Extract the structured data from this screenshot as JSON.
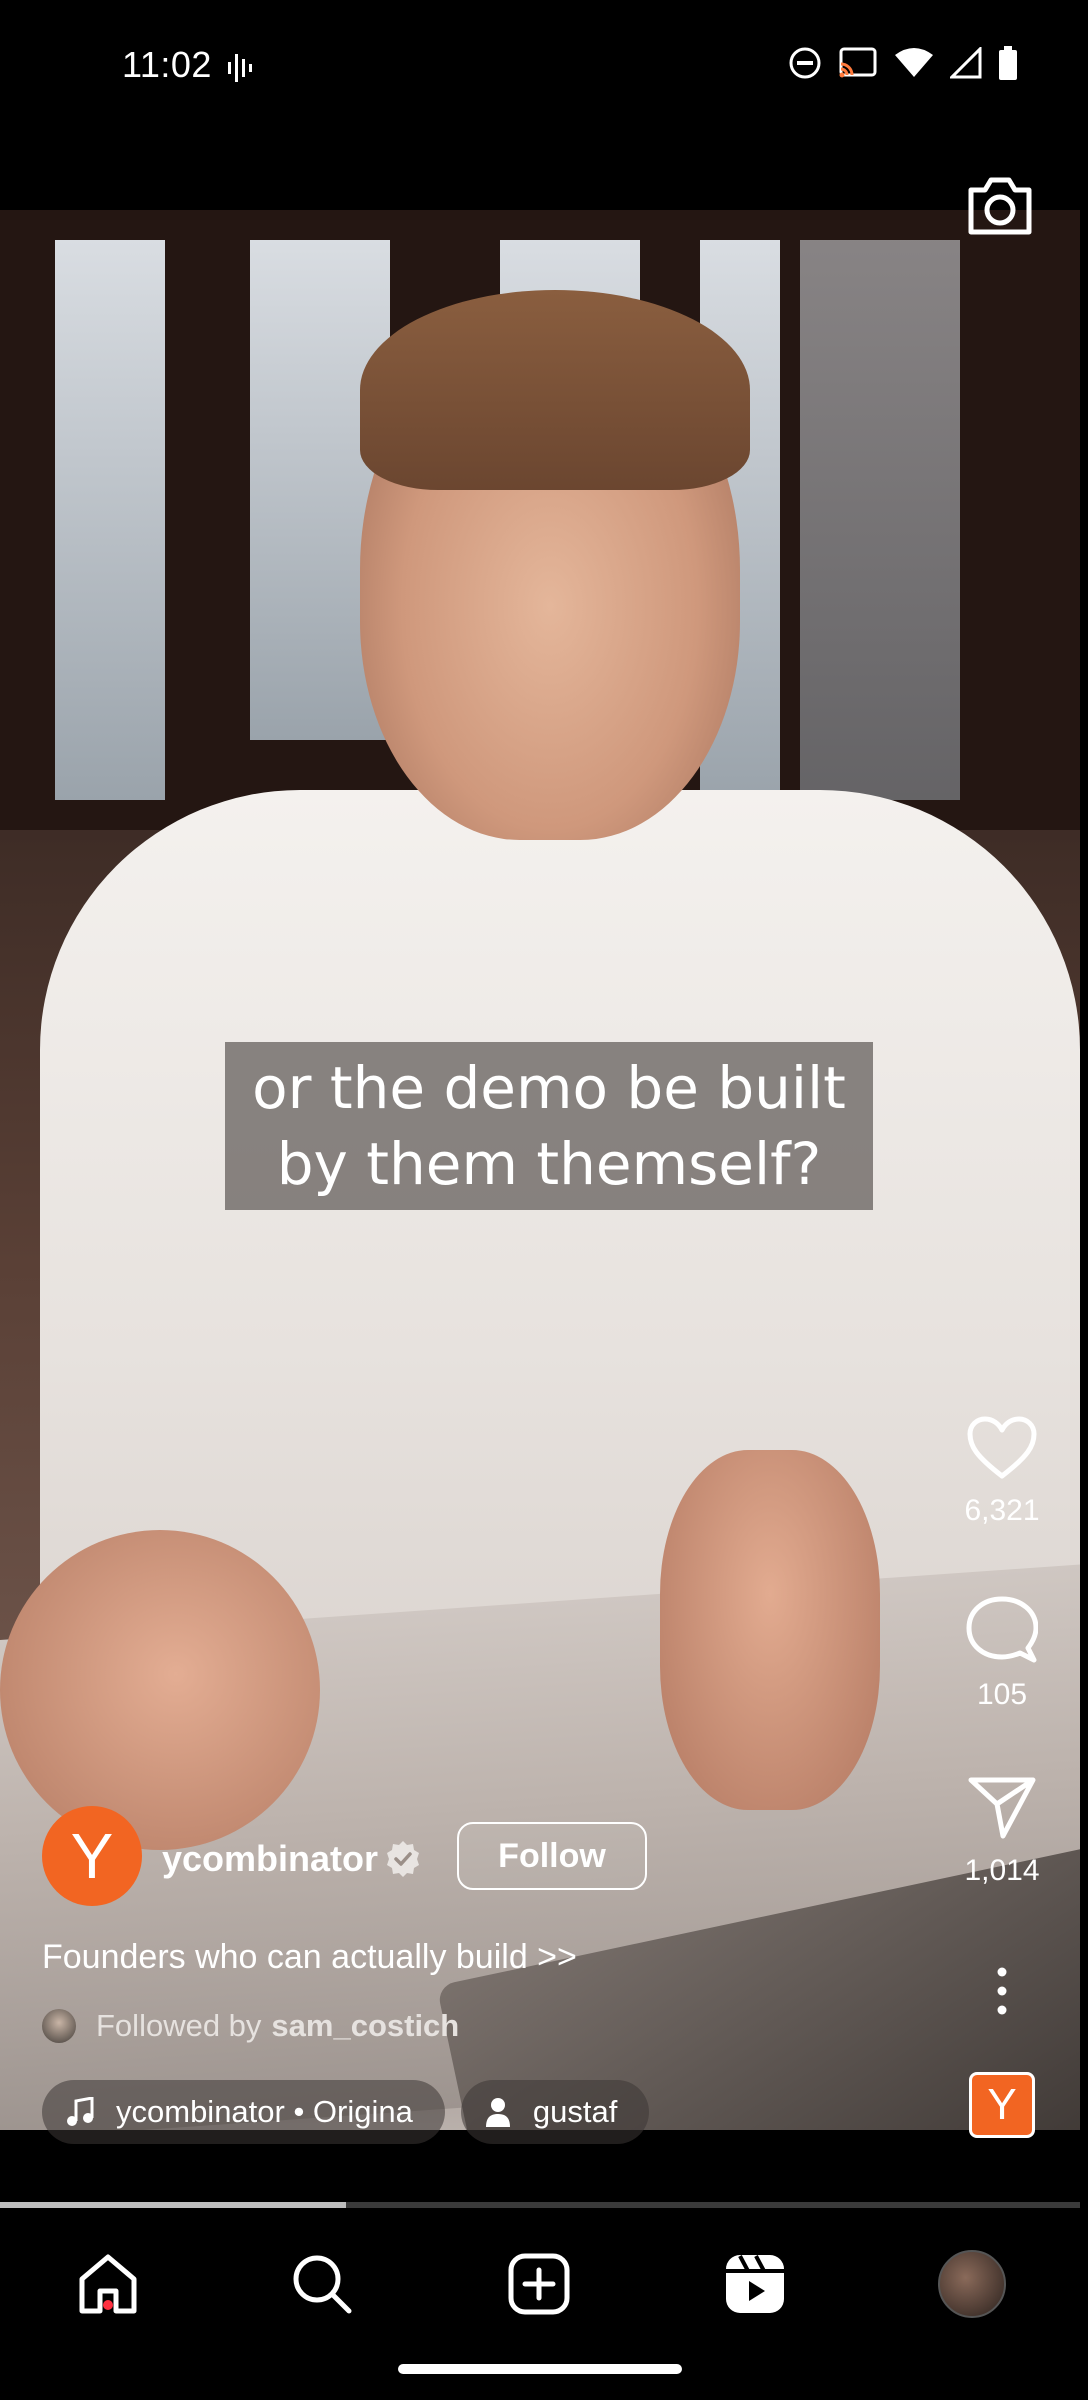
{
  "status_bar": {
    "time": "11:02"
  },
  "caption": {
    "line1": "or the demo be built",
    "line2": "by them themself?"
  },
  "actions": {
    "likes": "6,321",
    "comments": "105",
    "shares": "1,014"
  },
  "post": {
    "avatar_letter": "Y",
    "username": "ycombinator",
    "follow_label": "Follow",
    "description": "Founders who can actually build >>",
    "followed_by_prefix": "Followed by",
    "followed_by_user": "sam_costich",
    "audio_chip": "ycombinator • Origina",
    "tag_chip": "gustaf",
    "audio_tile_letter": "Y"
  },
  "playback": {
    "progress_percent": 32
  },
  "colors": {
    "brand": "#f26522",
    "notification": "#ff3040"
  },
  "nav": {
    "items": [
      "home-icon",
      "search-icon",
      "create-icon",
      "reels-icon",
      "profile-avatar"
    ]
  }
}
